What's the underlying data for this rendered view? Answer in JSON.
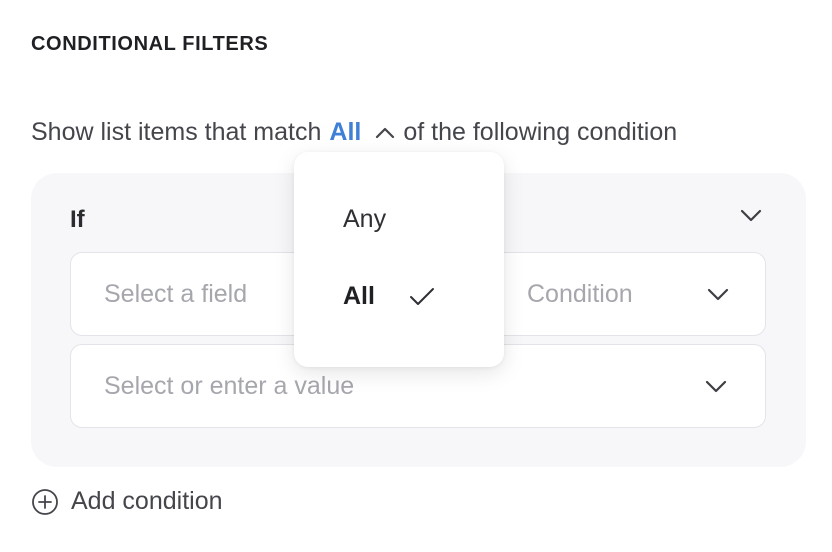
{
  "section_title": "CONDITIONAL FILTERS",
  "match_line": {
    "prefix": "Show list items that match",
    "selected": "All",
    "suffix": "of the following condition"
  },
  "filter_card": {
    "if_label": "If",
    "field_placeholder": "Select a field",
    "condition_placeholder": "Condition",
    "value_placeholder": "Select or enter a value"
  },
  "add_condition_label": "Add condition",
  "dropdown": {
    "options": [
      {
        "label": "Any",
        "selected": false
      },
      {
        "label": "All",
        "selected": true
      }
    ]
  },
  "colors": {
    "accent": "#3f7fd6",
    "card_bg": "#f7f7f9",
    "border": "#e3e4e8",
    "placeholder": "#a5a7ad"
  },
  "icons": {
    "toggle": "chevron-up-icon",
    "collapse": "chevron-down-icon",
    "selected": "checkmark-icon",
    "add": "plus-circle-icon"
  }
}
